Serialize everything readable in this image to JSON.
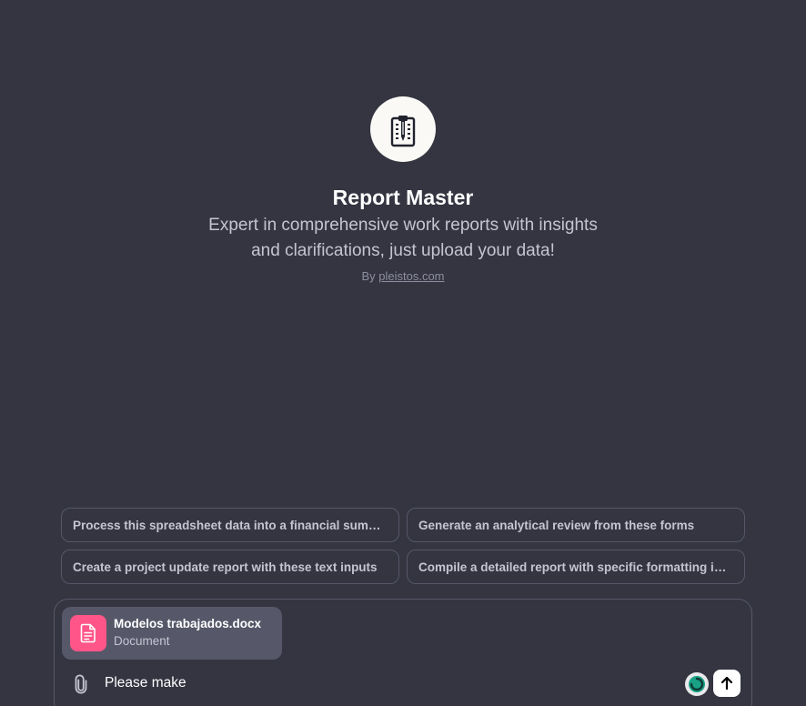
{
  "gpt": {
    "name": "Report Master",
    "description": "Expert in comprehensive work reports with insights and clarifications, just upload your data!",
    "author_prefix": "By",
    "author_link": "pleistos.com",
    "logo_icon": "report-pen-icon"
  },
  "suggestions": [
    {
      "label": "Process this spreadsheet data into a financial summary"
    },
    {
      "label": "Generate an analytical review from these forms"
    },
    {
      "label": "Create a project update report with these text inputs"
    },
    {
      "label": "Compile a detailed report with specific formatting inst..."
    }
  ],
  "composer": {
    "attachment": {
      "file_name": "Modelos trabajados.docx",
      "file_type": "Document",
      "icon": "document-icon",
      "icon_color": "#ff5588"
    },
    "input_value": "Please make",
    "attach_icon": "paperclip-icon",
    "send_icon": "arrow-up-icon"
  },
  "colors": {
    "background": "#343541",
    "border": "#565869",
    "accent_status": "#19a186"
  }
}
